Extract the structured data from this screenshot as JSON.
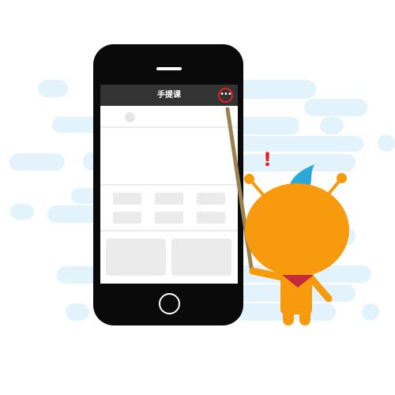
{
  "app": {
    "title": "手提课",
    "menu_glyph": "•••"
  },
  "illustration": {
    "alert_mark": "!",
    "colors": {
      "accent_orange": "#f79a0e",
      "highlight_red": "#e02020",
      "bubble_blue": "#e3f3fb",
      "nav_bar": "#333333",
      "pointer_stick": "#9a8350"
    },
    "icons": [
      "more-menu-icon",
      "avatar-placeholder",
      "home-button"
    ]
  }
}
